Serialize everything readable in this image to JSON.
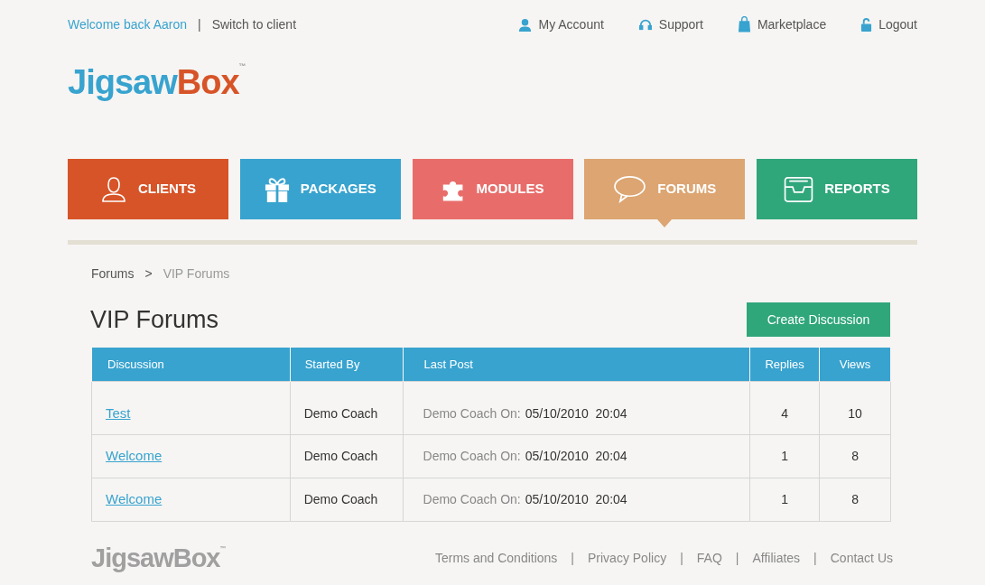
{
  "top_bar": {
    "welcome": "Welcome back Aaron",
    "separator": "|",
    "switch_link": "Switch to client",
    "links": [
      {
        "label": "My Account"
      },
      {
        "label": "Support"
      },
      {
        "label": "Marketplace"
      },
      {
        "label": "Logout"
      }
    ]
  },
  "logo": {
    "part_1": "Jigsaw",
    "part_2": "Box",
    "mark": "™"
  },
  "nav_tabs": [
    {
      "label": "CLIENTS",
      "color": "#d75428",
      "selected": false
    },
    {
      "label": "PACKAGES",
      "color": "#38a3cf",
      "selected": false
    },
    {
      "label": "MODULES",
      "color": "#e86d6a",
      "selected": false
    },
    {
      "label": "FORUMS",
      "color": "#dca572",
      "selected": true
    },
    {
      "label": "REPORTS",
      "color": "#30a67b",
      "selected": false
    }
  ],
  "breadcrumb": {
    "parent": "Forums",
    "separator": ">",
    "current": "VIP Forums"
  },
  "heading": "VIP Forums",
  "create_button": "Create Discussion",
  "table": {
    "columns": [
      "Discussion",
      "Started By",
      "Last Post",
      "Replies",
      "Views"
    ],
    "rows": [
      {
        "discussion": "Test",
        "started_by": "Demo Coach",
        "last_post_by": "Demo Coach On:",
        "last_post_date": "05/10/2010  20:04",
        "replies": "4",
        "views": "10"
      },
      {
        "discussion": "Welcome",
        "started_by": "Demo Coach",
        "last_post_by": "Demo Coach On:",
        "last_post_date": "05/10/2010  20:04",
        "replies": "1",
        "views": "8"
      },
      {
        "discussion": "Welcome",
        "started_by": "Demo Coach",
        "last_post_by": "Demo Coach On:",
        "last_post_date": "05/10/2010  20:04",
        "replies": "1",
        "views": "8"
      }
    ]
  },
  "footer": {
    "logo": "JigsawBox",
    "logo_mark": "™",
    "links": [
      "Terms and Conditions",
      "Privacy Policy",
      "FAQ",
      "Affiliates",
      "Contact Us"
    ],
    "separator": "|"
  }
}
